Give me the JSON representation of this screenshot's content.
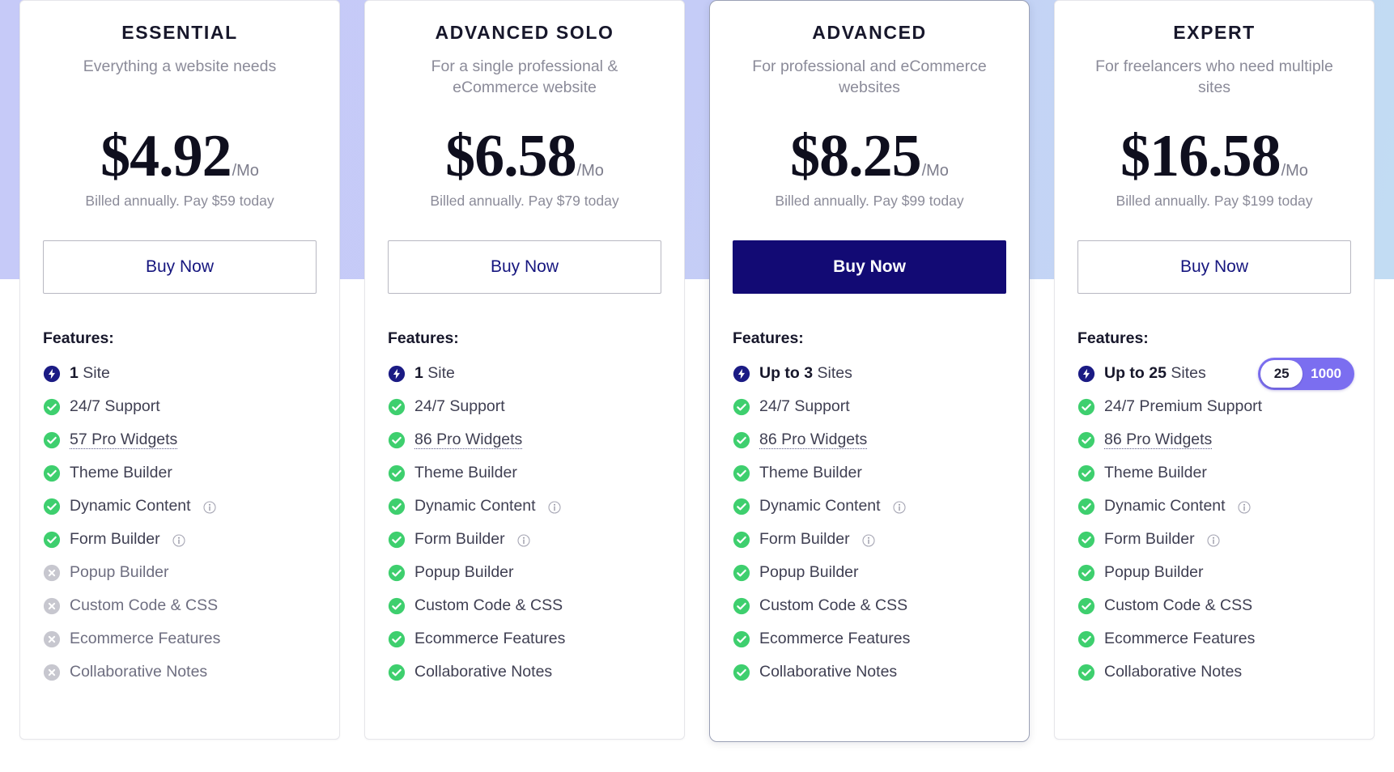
{
  "theme": {
    "band_gradient_from": "#c6caf8",
    "band_gradient_to": "#c2dcf3",
    "accent_navy": "#120a74",
    "link_navy": "#16167f",
    "check_green": "#3ecf6e",
    "disabled_gray": "#c7c7cf",
    "slider_purple": "#7b6ef0"
  },
  "labels": {
    "features_heading": "Features:",
    "buy_label": "Buy Now",
    "period_suffix": "/Mo"
  },
  "icons": {
    "bolt": "bolt-icon",
    "check": "check-circle-icon",
    "cross": "cross-circle-icon",
    "info": "info-icon"
  },
  "plans": [
    {
      "name": "ESSENTIAL",
      "tagline": "Everything a website needs",
      "price": "$4.92",
      "period": "/Mo",
      "billing": "Billed annually. Pay $59 today",
      "cta": "Buy Now",
      "cta_style": "outline",
      "featured": false,
      "features_heading": "Features:",
      "has_slider": false,
      "features": [
        {
          "icon": "bolt",
          "prefix": "1",
          "label": "Site",
          "state": "included",
          "info": false,
          "tooltip": false
        },
        {
          "icon": "check",
          "prefix": "",
          "label": "24/7 Support",
          "state": "included",
          "info": false,
          "tooltip": false
        },
        {
          "icon": "check",
          "prefix": "",
          "label": "57 Pro Widgets",
          "state": "included",
          "info": false,
          "tooltip": true
        },
        {
          "icon": "check",
          "prefix": "",
          "label": "Theme Builder",
          "state": "included",
          "info": false,
          "tooltip": false
        },
        {
          "icon": "check",
          "prefix": "",
          "label": "Dynamic Content",
          "state": "included",
          "info": true,
          "tooltip": false
        },
        {
          "icon": "check",
          "prefix": "",
          "label": "Form Builder",
          "state": "included",
          "info": true,
          "tooltip": false
        },
        {
          "icon": "cross",
          "prefix": "",
          "label": "Popup Builder",
          "state": "excluded",
          "info": false,
          "tooltip": false
        },
        {
          "icon": "cross",
          "prefix": "",
          "label": "Custom Code & CSS",
          "state": "excluded",
          "info": false,
          "tooltip": false
        },
        {
          "icon": "cross",
          "prefix": "",
          "label": "Ecommerce Features",
          "state": "excluded",
          "info": false,
          "tooltip": false
        },
        {
          "icon": "cross",
          "prefix": "",
          "label": "Collaborative Notes",
          "state": "excluded",
          "info": false,
          "tooltip": false
        }
      ]
    },
    {
      "name": "ADVANCED SOLO",
      "tagline": "For a single professional & eCommerce website",
      "price": "$6.58",
      "period": "/Mo",
      "billing": "Billed annually. Pay $79 today",
      "cta": "Buy Now",
      "cta_style": "outline",
      "featured": false,
      "features_heading": "Features:",
      "has_slider": false,
      "features": [
        {
          "icon": "bolt",
          "prefix": "1",
          "label": "Site",
          "state": "included",
          "info": false,
          "tooltip": false
        },
        {
          "icon": "check",
          "prefix": "",
          "label": "24/7 Support",
          "state": "included",
          "info": false,
          "tooltip": false
        },
        {
          "icon": "check",
          "prefix": "",
          "label": "86 Pro Widgets",
          "state": "included",
          "info": false,
          "tooltip": true
        },
        {
          "icon": "check",
          "prefix": "",
          "label": "Theme Builder",
          "state": "included",
          "info": false,
          "tooltip": false
        },
        {
          "icon": "check",
          "prefix": "",
          "label": "Dynamic Content",
          "state": "included",
          "info": true,
          "tooltip": false
        },
        {
          "icon": "check",
          "prefix": "",
          "label": "Form Builder",
          "state": "included",
          "info": true,
          "tooltip": false
        },
        {
          "icon": "check",
          "prefix": "",
          "label": "Popup Builder",
          "state": "included",
          "info": false,
          "tooltip": false
        },
        {
          "icon": "check",
          "prefix": "",
          "label": "Custom Code & CSS",
          "state": "included",
          "info": false,
          "tooltip": false
        },
        {
          "icon": "check",
          "prefix": "",
          "label": "Ecommerce Features",
          "state": "included",
          "info": false,
          "tooltip": false
        },
        {
          "icon": "check",
          "prefix": "",
          "label": "Collaborative Notes",
          "state": "included",
          "info": false,
          "tooltip": false
        }
      ]
    },
    {
      "name": "ADVANCED",
      "tagline": "For professional and eCommerce websites",
      "price": "$8.25",
      "period": "/Mo",
      "billing": "Billed annually. Pay $99 today",
      "cta": "Buy Now",
      "cta_style": "primary",
      "featured": true,
      "features_heading": "Features:",
      "has_slider": false,
      "features": [
        {
          "icon": "bolt",
          "prefix": "Up to 3",
          "label": "Sites",
          "state": "included",
          "info": false,
          "tooltip": false
        },
        {
          "icon": "check",
          "prefix": "",
          "label": "24/7 Support",
          "state": "included",
          "info": false,
          "tooltip": false
        },
        {
          "icon": "check",
          "prefix": "",
          "label": "86 Pro Widgets",
          "state": "included",
          "info": false,
          "tooltip": true
        },
        {
          "icon": "check",
          "prefix": "",
          "label": "Theme Builder",
          "state": "included",
          "info": false,
          "tooltip": false
        },
        {
          "icon": "check",
          "prefix": "",
          "label": "Dynamic Content",
          "state": "included",
          "info": true,
          "tooltip": false
        },
        {
          "icon": "check",
          "prefix": "",
          "label": "Form Builder",
          "state": "included",
          "info": true,
          "tooltip": false
        },
        {
          "icon": "check",
          "prefix": "",
          "label": "Popup Builder",
          "state": "included",
          "info": false,
          "tooltip": false
        },
        {
          "icon": "check",
          "prefix": "",
          "label": "Custom Code & CSS",
          "state": "included",
          "info": false,
          "tooltip": false
        },
        {
          "icon": "check",
          "prefix": "",
          "label": "Ecommerce Features",
          "state": "included",
          "info": false,
          "tooltip": false
        },
        {
          "icon": "check",
          "prefix": "",
          "label": "Collaborative Notes",
          "state": "included",
          "info": false,
          "tooltip": false
        }
      ]
    },
    {
      "name": "EXPERT",
      "tagline": "For freelancers who need multiple sites",
      "price": "$16.58",
      "period": "/Mo",
      "billing": "Billed annually. Pay $199 today",
      "cta": "Buy Now",
      "cta_style": "outline",
      "featured": false,
      "features_heading": "Features:",
      "has_slider": true,
      "slider": {
        "value": "25",
        "max": "1000"
      },
      "features": [
        {
          "icon": "bolt",
          "prefix": "Up to 25",
          "label": "Sites",
          "state": "included",
          "info": false,
          "tooltip": false
        },
        {
          "icon": "check",
          "prefix": "",
          "label": "24/7 Premium Support",
          "state": "included",
          "info": false,
          "tooltip": false
        },
        {
          "icon": "check",
          "prefix": "",
          "label": "86 Pro Widgets",
          "state": "included",
          "info": false,
          "tooltip": true
        },
        {
          "icon": "check",
          "prefix": "",
          "label": "Theme Builder",
          "state": "included",
          "info": false,
          "tooltip": false
        },
        {
          "icon": "check",
          "prefix": "",
          "label": "Dynamic Content",
          "state": "included",
          "info": true,
          "tooltip": false
        },
        {
          "icon": "check",
          "prefix": "",
          "label": "Form Builder",
          "state": "included",
          "info": true,
          "tooltip": false
        },
        {
          "icon": "check",
          "prefix": "",
          "label": "Popup Builder",
          "state": "included",
          "info": false,
          "tooltip": false
        },
        {
          "icon": "check",
          "prefix": "",
          "label": "Custom Code & CSS",
          "state": "included",
          "info": false,
          "tooltip": false
        },
        {
          "icon": "check",
          "prefix": "",
          "label": "Ecommerce Features",
          "state": "included",
          "info": false,
          "tooltip": false
        },
        {
          "icon": "check",
          "prefix": "",
          "label": "Collaborative Notes",
          "state": "included",
          "info": false,
          "tooltip": false
        }
      ]
    }
  ]
}
